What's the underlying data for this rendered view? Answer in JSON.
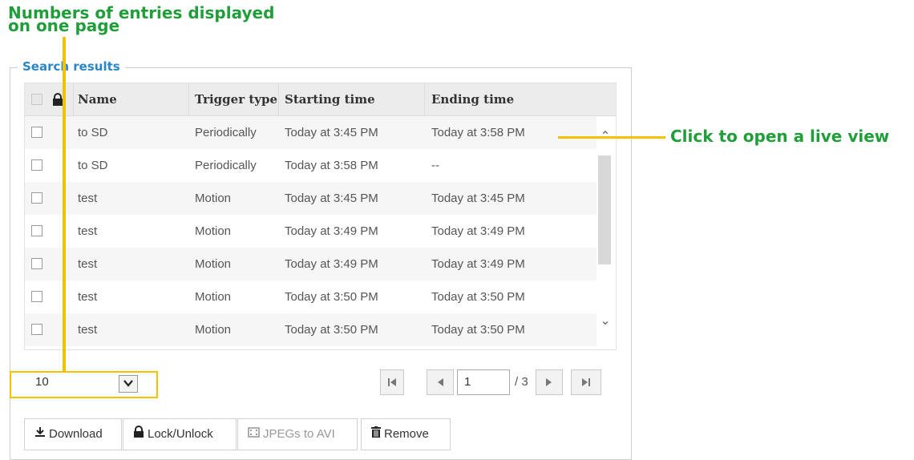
{
  "annotations": {
    "top_line1": "Numbers of entries displayed",
    "top_line2": "on one page",
    "right": "Click to open a live view"
  },
  "panel": {
    "legend": "Search results"
  },
  "columns": [
    "Name",
    "Trigger type",
    "Starting time",
    "Ending time"
  ],
  "rows": [
    {
      "name": "to SD",
      "trigger": "Periodically",
      "start": "Today at 3:45 PM",
      "end": "Today at 3:58 PM"
    },
    {
      "name": "to SD",
      "trigger": "Periodically",
      "start": "Today at 3:58 PM",
      "end": "--"
    },
    {
      "name": "test",
      "trigger": "Motion",
      "start": "Today at 3:45 PM",
      "end": "Today at 3:45 PM"
    },
    {
      "name": "test",
      "trigger": "Motion",
      "start": "Today at 3:49 PM",
      "end": "Today at 3:49 PM"
    },
    {
      "name": "test",
      "trigger": "Motion",
      "start": "Today at 3:49 PM",
      "end": "Today at 3:49 PM"
    },
    {
      "name": "test",
      "trigger": "Motion",
      "start": "Today at 3:50 PM",
      "end": "Today at 3:50 PM"
    },
    {
      "name": "test",
      "trigger": "Motion",
      "start": "Today at 3:50 PM",
      "end": "Today at 3:50 PM"
    }
  ],
  "pagination": {
    "page_size": "10",
    "current_page": "1",
    "total": "/ 3"
  },
  "actions": {
    "download": "Download",
    "lock": "Lock/Unlock",
    "jpegs": "JPEGs to AVI",
    "remove": "Remove"
  },
  "colors": {
    "annotation": "#1f9e3a",
    "highlight": "#f2c200",
    "legend": "#2a86c7"
  }
}
